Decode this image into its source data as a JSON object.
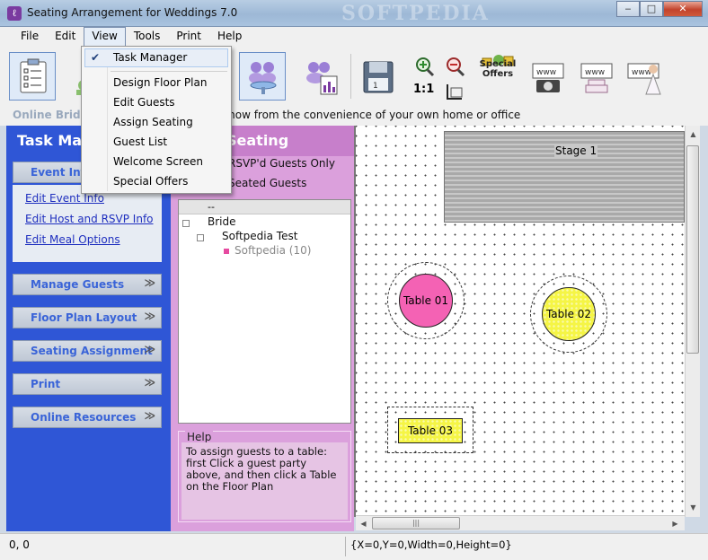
{
  "window": {
    "title": "Seating Arrangement for Weddings 7.0",
    "watermark": "SOFTPEDIA",
    "minimize": "‒",
    "maximize": "□",
    "close": "✕"
  },
  "menubar": [
    "File",
    "Edit",
    "View",
    "Tools",
    "Print",
    "Help"
  ],
  "view_menu": {
    "items": [
      {
        "label": "Task Manager",
        "checked": true
      },
      {
        "label": "Design Floor Plan"
      },
      {
        "label": "Edit Guests"
      },
      {
        "label": "Assign Seating"
      },
      {
        "label": "Guest List"
      },
      {
        "label": "Welcome Screen"
      },
      {
        "label": "Special Offers"
      }
    ],
    "check_glyph": "✔"
  },
  "toolbar": {
    "zoom_reset": "1:1",
    "special_offers": "Special Offers",
    "icons": [
      "task-list-icon",
      "guests-icon",
      "assign-seating-icon",
      "guest-chart-icon",
      "save-icon",
      "zoom-in-icon",
      "zoom-out-icon",
      "fit-icon",
      "special-offers-icon",
      "www-camera-icon",
      "www-cake-icon",
      "www-bride-icon"
    ]
  },
  "ticker": {
    "brand": "Online Bridal",
    "message": "al Show from the convenience of your own home or office"
  },
  "task_pane": {
    "title": "Task Mana",
    "sections": [
      {
        "label": "Event Info",
        "links": [
          "Edit Event Info",
          "Edit Host and RSVP Info",
          "Edit Meal Options"
        ]
      },
      {
        "label": "Manage Guests"
      },
      {
        "label": "Floor Plan Layout"
      },
      {
        "label": "Seating Assignment"
      },
      {
        "label": "Print"
      },
      {
        "label": "Online Resources"
      }
    ],
    "chevron": "≫"
  },
  "seating_pane": {
    "title": "Seating",
    "filter1": "RSVP'd Guests Only",
    "filter2": "Seated Guests",
    "tree_header": "--",
    "tree": {
      "root": "Bride",
      "child": "Softpedia Test",
      "leaf": "Softpedia (10)"
    },
    "help_title": "Help",
    "help_text": "To assign guests to a table: first Click a guest party above, and then click a Table on the Floor Plan"
  },
  "floor_plan": {
    "stage": "Stage 1",
    "tables": [
      {
        "label": "Table 01",
        "color": "#f462b4"
      },
      {
        "label": "Table 02",
        "color": "#f5f545"
      },
      {
        "label": "Table 03",
        "color": "#f5f545"
      }
    ],
    "hscroll_grip": "|||"
  },
  "statusbar": {
    "coords": "0, 0",
    "selection": "{X=0,Y=0,Width=0,Height=0}"
  }
}
